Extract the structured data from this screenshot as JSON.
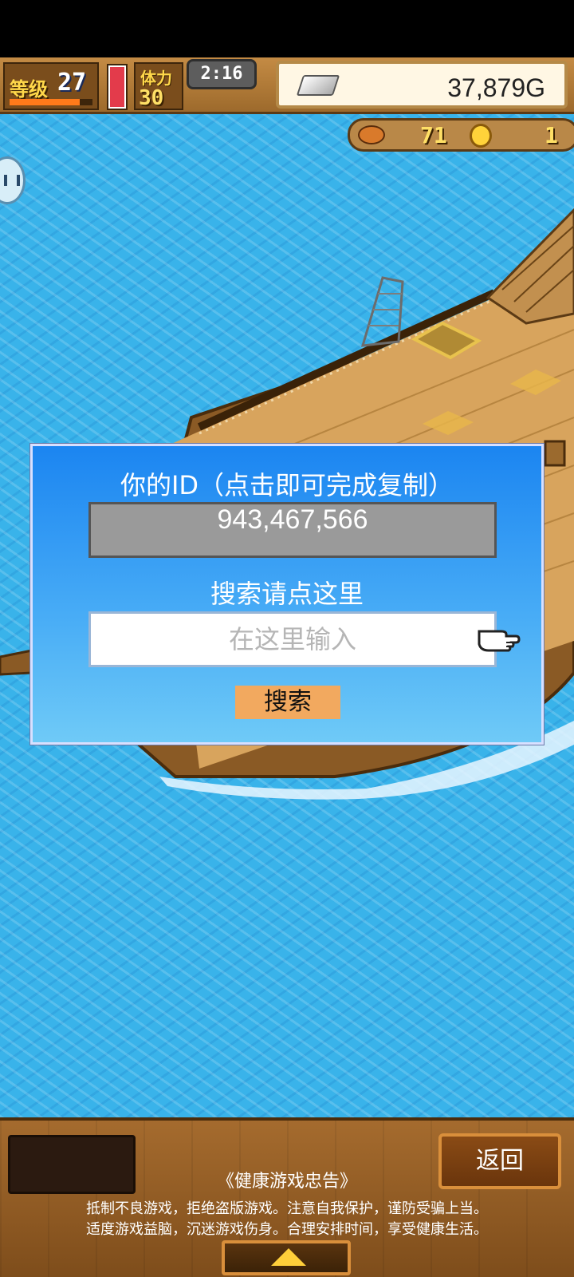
{
  "hud": {
    "level_label": "等级",
    "level": "27",
    "level_progress": 0.85,
    "stamina_label": "体力",
    "stamina": "30",
    "stamina_gauge": 1.0,
    "timer": "2:16",
    "gold": "37,879G",
    "resource_1": "71",
    "resource_2": "1"
  },
  "dialog": {
    "title": "你的ID（点击即可完成复制）",
    "user_id": "943,467,566",
    "search_heading": "搜索请点这里",
    "search_placeholder": "在这里输入",
    "search_button": "搜索"
  },
  "bottom": {
    "back_button": "返回",
    "notice_title": "《健康游戏忠告》",
    "notice_line_1": "抵制不良游戏，拒绝盗版游戏。注意自我保护，谨防受骗上当。",
    "notice_line_2": "适度游戏益脑，沉迷游戏伤身。合理安排时间，享受健康生活。"
  },
  "colors": {
    "ocean": "#39b3ea",
    "dialog_top": "#1b85f1",
    "dialog_bottom": "#6fcaf7",
    "search_button": "#f2a95f",
    "wood": "#a56b2e"
  }
}
